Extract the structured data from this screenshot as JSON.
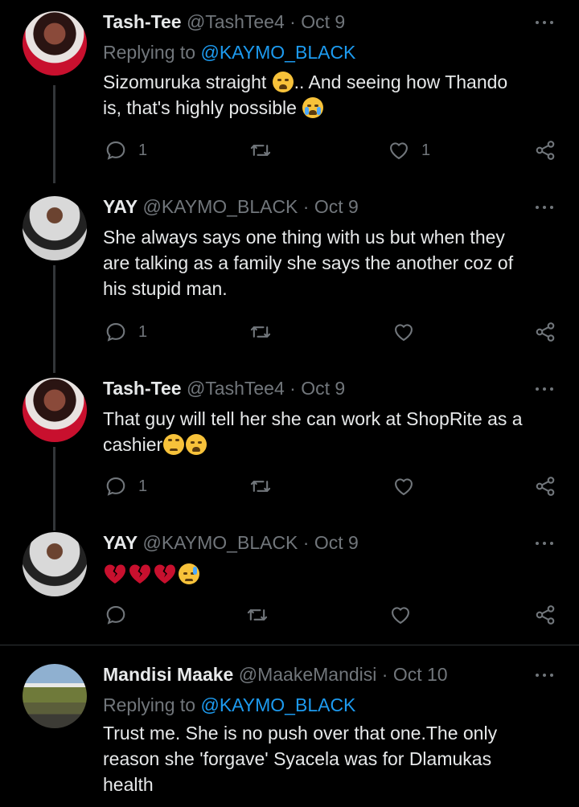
{
  "tweets": [
    {
      "name": "Tash-Tee",
      "handle": "@TashTee4",
      "date": "Oct 9",
      "replying_prefix": "Replying to",
      "replying_to": "@KAYMO_BLACK",
      "text_parts": [
        "Sizomuruka straight ",
        ".. And seeing how Thando",
        "is, that's highly possible "
      ],
      "replies": "1",
      "retweets": "",
      "likes": "1"
    },
    {
      "name": "YAY",
      "handle": "@KAYMO_BLACK",
      "date": "Oct 9",
      "text_lines": [
        "She always says one thing with us but when they",
        "are talking as a family she says the another coz of",
        "his stupid man."
      ],
      "replies": "1",
      "retweets": "",
      "likes": ""
    },
    {
      "name": "Tash-Tee",
      "handle": "@TashTee4",
      "date": "Oct 9",
      "text_lines": [
        "That guy will tell her she can work at ShopRite as a",
        "cashier"
      ],
      "replies": "1",
      "retweets": "",
      "likes": ""
    },
    {
      "name": "YAY",
      "handle": "@KAYMO_BLACK",
      "date": "Oct 9",
      "replies": "",
      "retweets": "",
      "likes": ""
    },
    {
      "name": "Mandisi Maake",
      "handle": "@MaakeMandisi",
      "date": "Oct 10",
      "replying_prefix": "Replying to",
      "replying_to": "@KAYMO_BLACK",
      "text_lines": [
        "Trust me. She is no push over that one.The only",
        "reason she 'forgave' Syacela was for Dlamukas",
        "health"
      ]
    }
  ],
  "separator": "·",
  "icons": [
    "reply-icon",
    "retweet-icon",
    "like-icon",
    "share-icon",
    "more-icon"
  ],
  "colors": {
    "accent": "#1d9bf0",
    "muted": "#71767b",
    "background": "#000000",
    "heart": "#c8102e"
  }
}
